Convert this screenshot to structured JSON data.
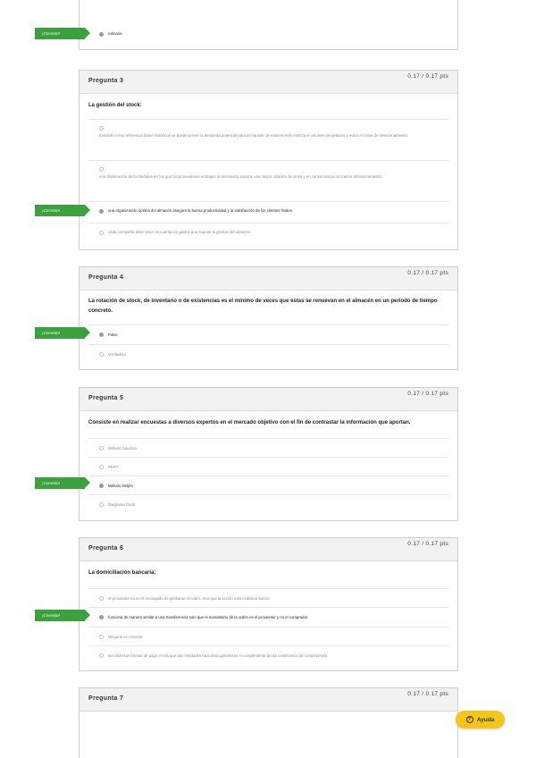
{
  "correct_tag": "¡Correcto!",
  "help": {
    "label": "Ayuda",
    "icon": "?"
  },
  "top_fragment": {
    "option": "rutinaria"
  },
  "q3": {
    "title": "Pregunta 3",
    "score": "0.17 / 0.17 pts",
    "question": "La gestión del stock:",
    "options": [
      "tomando como referencia datos históricos se puede prever la demanda potencial para así ajustar de manera más estricta el volumen de pedidos y evitar el coste de almacenamiento",
      "una disminución de los tiempos en los que los proveedores entregan la mercancía supone una mayor rotación de stock y en consecuencia un menor almacenamiento",
      "una organización óptima del almacén asegura la buena productividad y la satisfacción de los clientes finales.",
      "cada compañía debe tener en cuenta los gastos que supone la gestión del almacén"
    ]
  },
  "q4": {
    "title": "Pregunta 4",
    "score": "0.17 / 0.17 pts",
    "question": "La rotación de stock, de inventario o de existencias es el mínimo de veces que estas se renuevan en el almacén en un periodo de tiempo concreto.",
    "options": [
      "Falso",
      "Verdadero"
    ]
  },
  "q5": {
    "title": "Pregunta 5",
    "score": "0.17 / 0.17 pts",
    "question": "Consiste en realizar encuestas a diversos expertos en el mercado objetivo con el fin de contrastar la información que aportan.",
    "options": [
      "Método inductivo",
      "PERT",
      "Método Delphi",
      "Diagrama Gantt"
    ]
  },
  "q6": {
    "title": "Pregunta 6",
    "score": "0.17 / 0.17 pts",
    "question": "La domiciliación bancaria:",
    "options": [
      "el proveedor no es el encargado de gestionar el cobro, sino que la acción está cedida al banco",
      "funciona de manera similar a una transferencia solo que el mandatario de la orden es el proveedor y no el comprador.",
      "Ninguna es correcta",
      "son diversas formas de pago en las que dos entidades bancarias garantizan el cumplimiento de las condiciones de compraventa"
    ]
  },
  "q7": {
    "title": "Pregunta 7",
    "score": "0.17 / 0.17 pts"
  }
}
